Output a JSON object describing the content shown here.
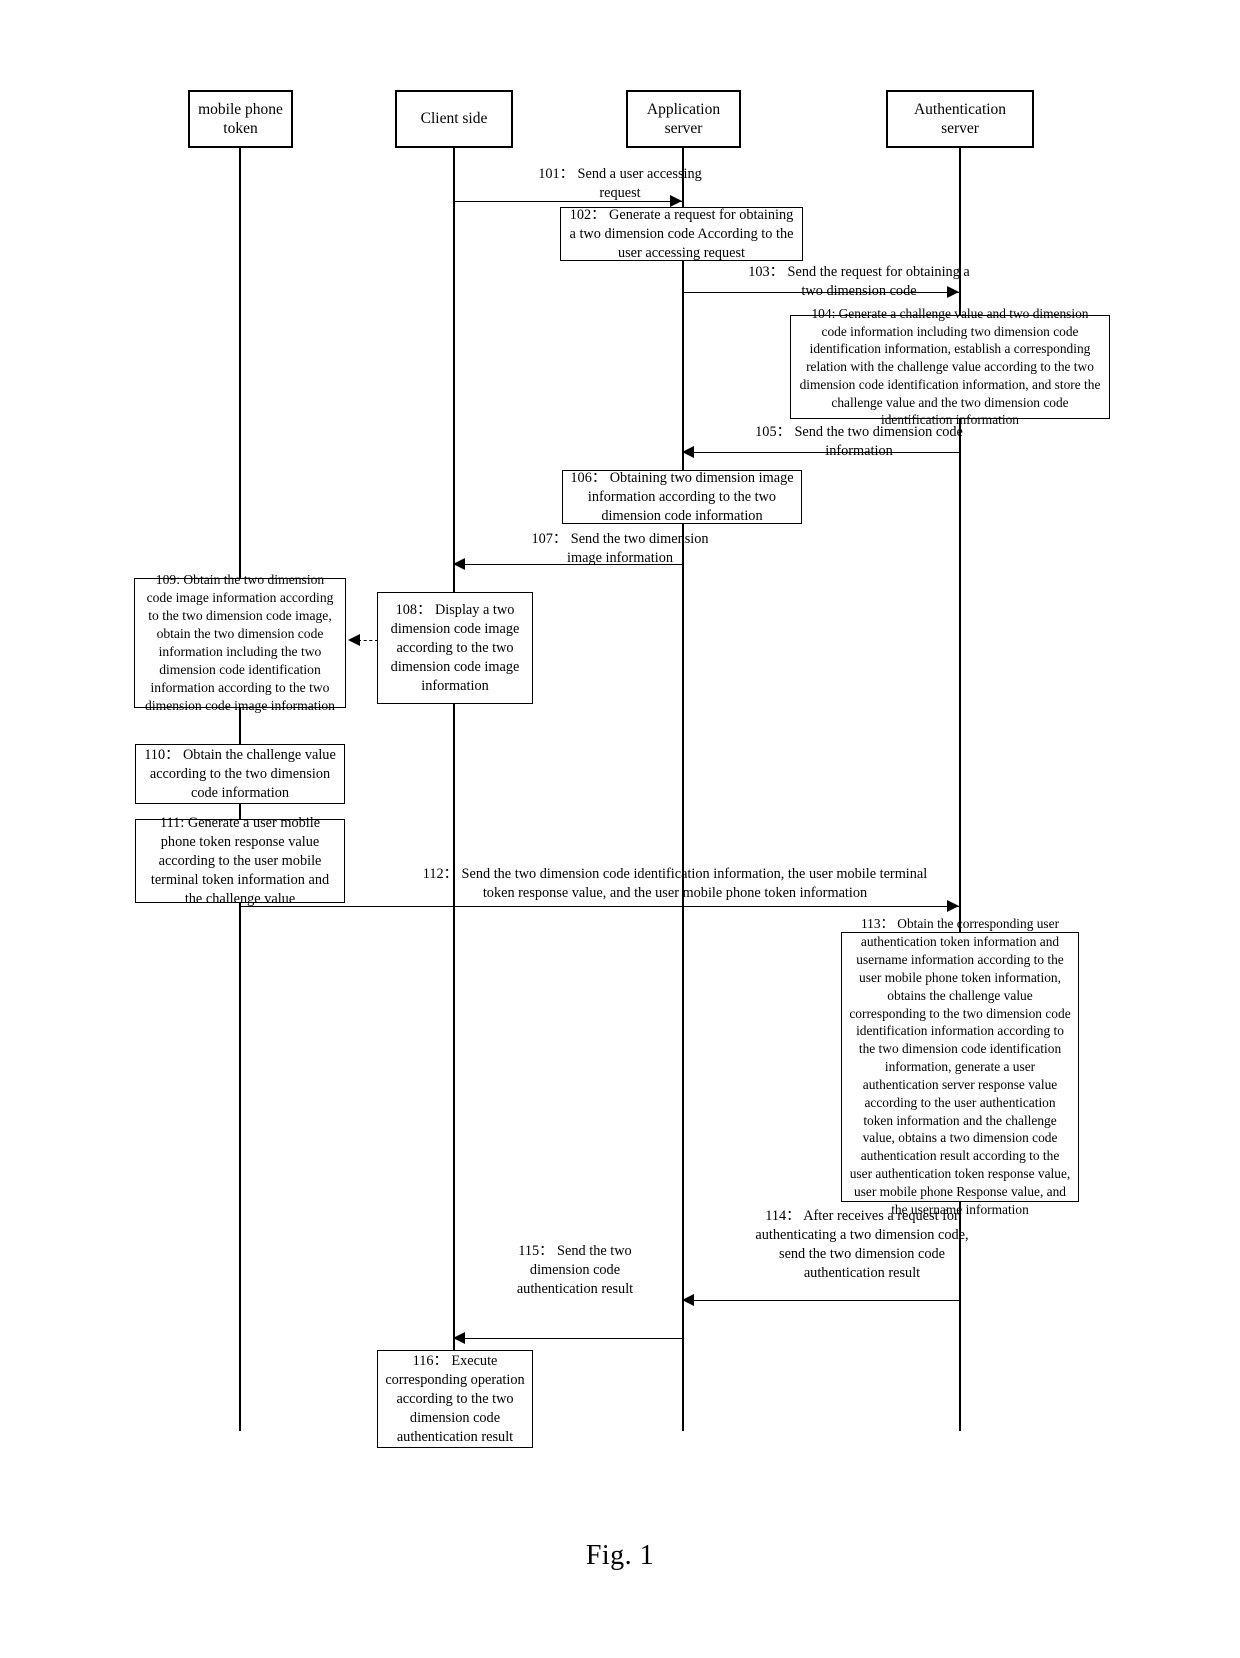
{
  "figure": {
    "caption": "Fig. 1",
    "type": "uml-sequence-diagram"
  },
  "lifelines": [
    {
      "id": "mobile-phone-token",
      "label": "mobile phone\ntoken"
    },
    {
      "id": "client-side",
      "label": "Client side"
    },
    {
      "id": "application-server",
      "label": "Application\nserver"
    },
    {
      "id": "authentication-server",
      "label": "Authentication server"
    }
  ],
  "messages": [
    {
      "id": "101",
      "label": "101：  Send a user accessing\nrequest",
      "from": "client-side",
      "to": "application-server",
      "direction": "right"
    },
    {
      "id": "103",
      "label": "103：   Send the request for obtaining a\ntwo dimension code",
      "from": "application-server",
      "to": "authentication-server",
      "direction": "right"
    },
    {
      "id": "105",
      "label": "105：  Send the two dimension code\ninformation",
      "from": "authentication-server",
      "to": "application-server",
      "direction": "left"
    },
    {
      "id": "107",
      "label": "107：  Send the two dimension\nimage information",
      "from": "application-server",
      "to": "client-side",
      "direction": "left"
    },
    {
      "id": "112",
      "label": "112：  Send the two dimension code identification information, the user mobile terminal\ntoken response value, and the user mobile phone token information",
      "from": "mobile-phone-token",
      "to": "authentication-server",
      "direction": "right"
    },
    {
      "id": "114",
      "label": "114：  After receives a request for\nauthenticating a two dimension code,\nsend the two dimension code\nauthentication result",
      "from": "authentication-server",
      "to": "application-server",
      "direction": "left"
    },
    {
      "id": "115",
      "label": "115：  Send the two\ndimension code\nauthentication result",
      "from": "application-server",
      "to": "client-side",
      "direction": "left"
    },
    {
      "id": "109-link",
      "label": "",
      "from": "client-side",
      "to": "mobile-phone-token",
      "direction": "left-dashed"
    }
  ],
  "processes": [
    {
      "id": "102",
      "owner": "application-server",
      "text": "102：   Generate a request for obtaining a two dimension code According to the user accessing request"
    },
    {
      "id": "104",
      "owner": "authentication-server",
      "text": "104: Generate a challenge value and two dimension code information including two dimension code identification information, establish a corresponding relation with the challenge value according to the two dimension code identification information, and store the challenge value and the two dimension code identification information"
    },
    {
      "id": "106",
      "owner": "application-server",
      "text": "106：  Obtaining two dimension image information according to the two dimension code information"
    },
    {
      "id": "108",
      "owner": "client-side",
      "text": "108：  Display a two dimension code image according to the two dimension code image information"
    },
    {
      "id": "109",
      "owner": "mobile-phone-token",
      "text": "109: Obtain the two dimension code image information according to the two dimension code image, obtain the two dimension code information including the two dimension code identification information according to the two dimension code image information"
    },
    {
      "id": "110",
      "owner": "mobile-phone-token",
      "text": "110：  Obtain the challenge value according to the two dimension code information"
    },
    {
      "id": "111",
      "owner": "mobile-phone-token",
      "text": "111: Generate a user mobile phone token response value according to the user mobile terminal token information and the challenge value"
    },
    {
      "id": "113",
      "owner": "authentication-server",
      "text": "113：  Obtain the corresponding user authentication token information and username information according to the user mobile phone token information, obtains the challenge value corresponding to the two dimension code identification information according to the two dimension code identification information, generate a user authentication server response value according to the user authentication token information and the challenge value, obtains a two dimension code authentication result  according to the user authentication token response value, user mobile  phone Response value, and the username information"
    },
    {
      "id": "116",
      "owner": "client-side",
      "text": "116：  Execute corresponding operation according to the two dimension code authentication result"
    }
  ]
}
